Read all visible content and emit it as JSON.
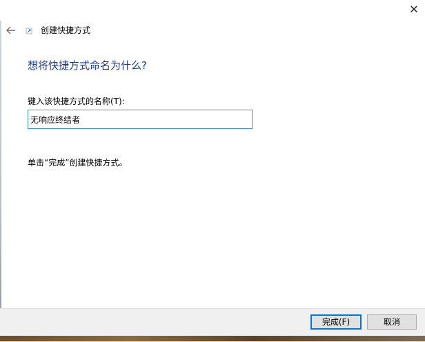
{
  "wizard": {
    "title": "创建快捷方式",
    "heading": "想将快捷方式命名为什么?",
    "name_label": "键入该快捷方式的名称(T):",
    "name_value": "无响应终结者",
    "hint": "单击“完成”创建快捷方式。"
  },
  "buttons": {
    "finish_label": "完成(F)",
    "cancel_label": "取消"
  },
  "icons": {
    "close": "close-icon",
    "back": "back-arrow-icon",
    "wizard": "shortcut-icon"
  }
}
